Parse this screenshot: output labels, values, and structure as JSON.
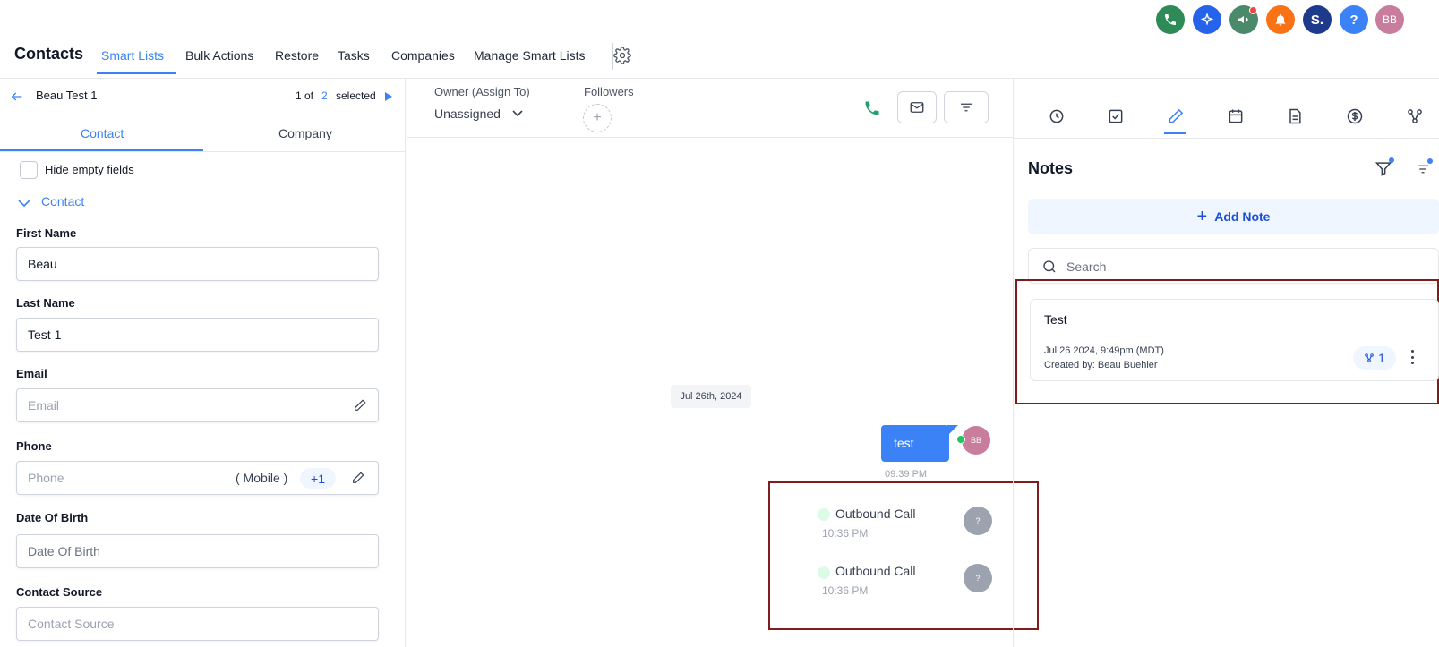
{
  "topbar": {
    "icons": [
      {
        "name": "phone-icon",
        "color": "#2e8b57"
      },
      {
        "name": "ai-sparkle-icon",
        "color": "#2563eb"
      },
      {
        "name": "megaphone-icon",
        "color": "#4a8a6b"
      },
      {
        "name": "bell-icon",
        "color": "#f97316"
      },
      {
        "name": "s-app-icon",
        "color": "#1e3a8a",
        "text": "S."
      },
      {
        "name": "help-icon",
        "color": "#3b82f6",
        "text": "?"
      },
      {
        "name": "user-avatar",
        "color": "#c77d9b",
        "text": "BB"
      }
    ]
  },
  "nav": {
    "title": "Contacts",
    "items": [
      "Smart Lists",
      "Bulk Actions",
      "Restore",
      "Tasks",
      "Companies",
      "Manage Smart Lists"
    ]
  },
  "record": {
    "name": "Beau Test 1",
    "pager_prefix": "1 of",
    "pager_count": "2",
    "pager_suffix": "selected"
  },
  "left_tabs": [
    "Contact",
    "Company"
  ],
  "hide_empty": "Hide empty fields",
  "section_title": "Contact",
  "fields": {
    "first_name": {
      "label": "First Name",
      "value": "Beau"
    },
    "last_name": {
      "label": "Last Name",
      "value": "Test 1"
    },
    "email": {
      "label": "Email",
      "placeholder": "Email"
    },
    "phone": {
      "label": "Phone",
      "placeholder": "Phone",
      "type": "( Mobile )",
      "code": "+1"
    },
    "dob": {
      "label": "Date Of Birth",
      "placeholder": "Date Of Birth"
    },
    "source": {
      "label": "Contact Source",
      "placeholder": "Contact Source"
    }
  },
  "owner": {
    "label": "Owner (Assign To)",
    "value": "Unassigned"
  },
  "followers": {
    "label": "Followers"
  },
  "conversation": {
    "date": "Jul 26th, 2024",
    "message": {
      "text": "test",
      "time": "09:39 PM",
      "avatar": "BB"
    },
    "calls": [
      {
        "title": "Outbound Call",
        "time": "10:36 PM",
        "avatar": "?"
      },
      {
        "title": "Outbound Call",
        "time": "10:36 PM",
        "avatar": "?"
      }
    ]
  },
  "notes_panel": {
    "title": "Notes",
    "add_note": "Add Note",
    "search_placeholder": "Search",
    "note": {
      "title": "Test",
      "date": "Jul 26 2024, 9:49pm (MDT)",
      "created_by": "Created by: Beau Buehler",
      "assoc_count": "1"
    }
  },
  "colors": {
    "accent": "#3b82f6",
    "highlight_border": "#7f1d1d",
    "call_green": "#22a06b"
  }
}
